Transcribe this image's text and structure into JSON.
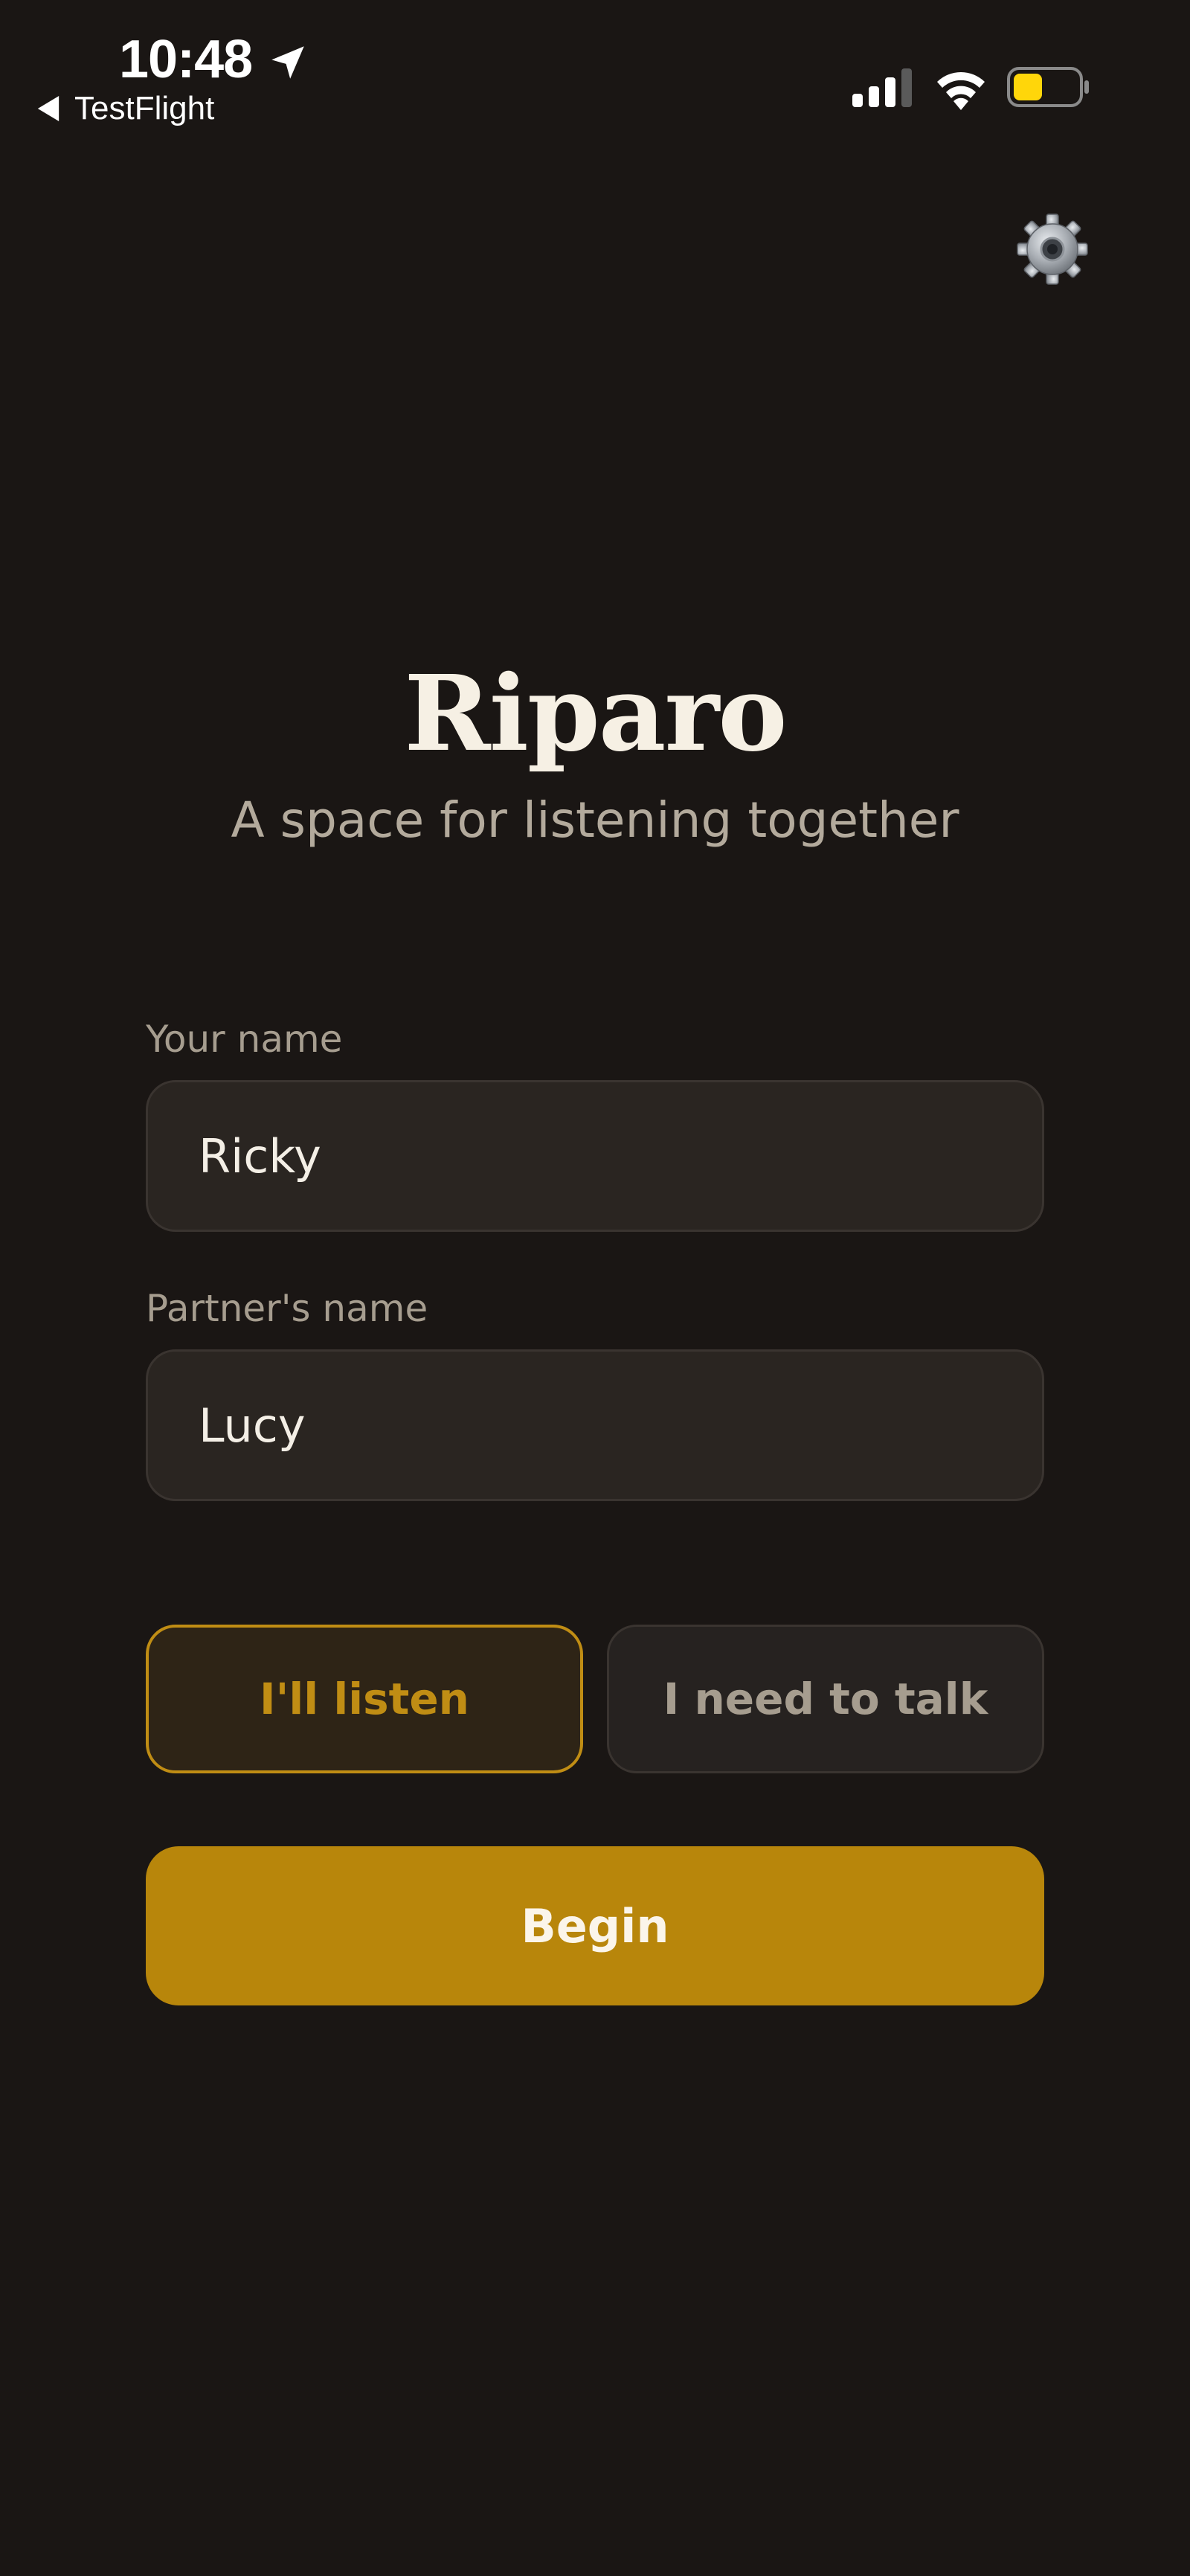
{
  "status_bar": {
    "time": "10:48",
    "back_label": "TestFlight",
    "icons": [
      "location-arrow-icon",
      "cellular-signal-icon",
      "wifi-icon",
      "battery-icon"
    ],
    "battery_color": "#ffd60a"
  },
  "header": {
    "settings_icon": "gear-icon",
    "title": "Riparo",
    "subtitle": "A space for listening together"
  },
  "form": {
    "your_name": {
      "label": "Your name",
      "value": "Ricky"
    },
    "partner_name": {
      "label": "Partner's name",
      "value": "Lucy"
    }
  },
  "roles": {
    "options": [
      {
        "label": "I'll listen",
        "selected": true
      },
      {
        "label": "I need to talk",
        "selected": false
      }
    ]
  },
  "actions": {
    "begin_label": "Begin"
  },
  "colors": {
    "background": "#1a1614",
    "accent": "#b8860b",
    "accent_text": "#c08d14",
    "field_background": "#2a2521",
    "muted_text": "#a69d8f"
  }
}
